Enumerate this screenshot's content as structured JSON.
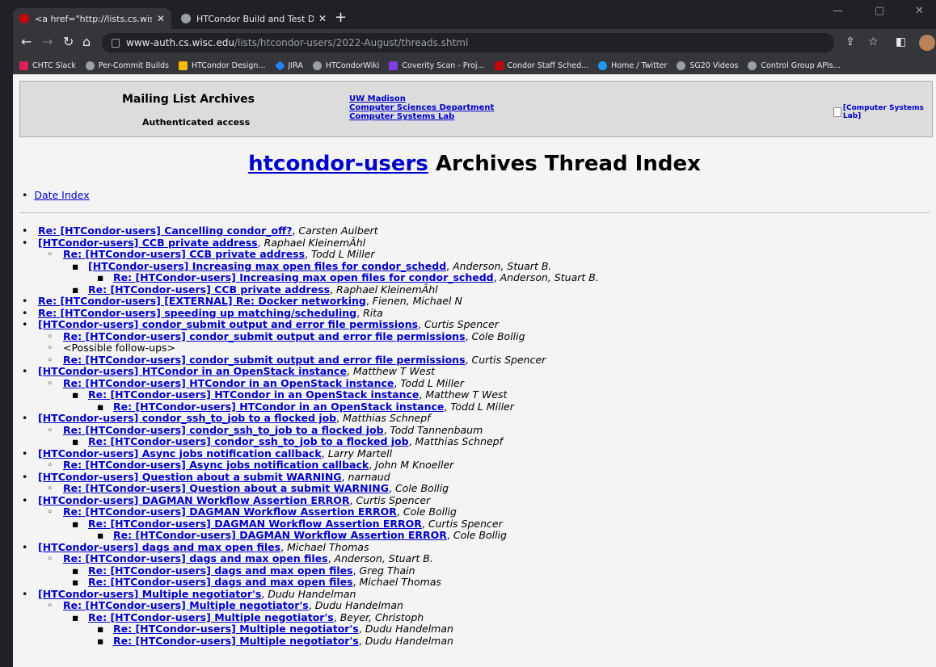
{
  "tabs": [
    {
      "title": "<a href=\"http://lists.cs.wisc.edu/",
      "fav_color": "#c5050c"
    },
    {
      "title": "HTCondor Build and Test Dashbo",
      "fav_color": "#9aa0a6"
    }
  ],
  "window_controls": {
    "minimize": "—",
    "maximize": "▢",
    "close": "✕"
  },
  "address": {
    "host": "www-auth.cs.wisc.edu",
    "path": "/lists/htcondor-users/2022-August/threads.shtml"
  },
  "bookmarks": [
    {
      "label": "CHTC Slack",
      "color": "#e01e5a"
    },
    {
      "label": "Per-Commit Builds",
      "color": "#9aa0a6"
    },
    {
      "label": "HTCondor Design...",
      "color": "#fbbc04"
    },
    {
      "label": "JIRA",
      "color": "#2684ff"
    },
    {
      "label": "HTCondorWiki",
      "color": "#9aa0a6"
    },
    {
      "label": "Coverity Scan - Proj...",
      "color": "#7b3fe4"
    },
    {
      "label": "Condor Staff Sched...",
      "color": "#c5050c"
    },
    {
      "label": "Home / Twitter",
      "color": "#1d9bf0"
    },
    {
      "label": "SG20 Videos",
      "color": "#9aa0a6"
    },
    {
      "label": "Control Group APIs...",
      "color": "#9aa0a6"
    }
  ],
  "header": {
    "title": "Mailing List Archives",
    "subtitle": "Authenticated access",
    "links": [
      "UW Madison",
      "Computer Sciences Department",
      "Computer Systems Lab"
    ],
    "image_alt": "[Computer Systems Lab]"
  },
  "page_title": {
    "link": "htcondor-users",
    "rest": " Archives Thread Index"
  },
  "date_index": "Date Index",
  "threads": [
    {
      "level": 0,
      "subject": "Re: [HTCondor-users] Cancelling condor_off?",
      "author": "Carsten Aulbert"
    },
    {
      "level": 0,
      "subject": "[HTCondor-users] CCB private address",
      "author": "Raphael KleinemÃhl"
    },
    {
      "level": 1,
      "subject": "Re: [HTCondor-users] CCB private address",
      "author": "Todd L Miller"
    },
    {
      "level": 2,
      "subject": "[HTCondor-users] Increasing max open files for condor_schedd",
      "author": "Anderson, Stuart B."
    },
    {
      "level": 3,
      "subject": "Re: [HTCondor-users] Increasing max open files for condor_schedd",
      "author": "Anderson, Stuart B."
    },
    {
      "level": 2,
      "subject": "Re: [HTCondor-users] CCB private address",
      "author": "Raphael KleinemÃhl"
    },
    {
      "level": 0,
      "subject": "Re: [HTCondor-users] [EXTERNAL] Re: Docker networking",
      "author": "Fienen, Michael N"
    },
    {
      "level": 0,
      "subject": "Re: [HTCondor-users] speeding up matching/scheduling",
      "author": "Rita"
    },
    {
      "level": 0,
      "subject": "[HTCondor-users] condor_submit output and error file permissions",
      "author": "Curtis Spencer"
    },
    {
      "level": 1,
      "subject": "Re: [HTCondor-users] condor_submit output and error file permissions",
      "author": "Cole Bollig"
    },
    {
      "level": 1,
      "text": "<Possible follow-ups>"
    },
    {
      "level": 1,
      "subject": "Re: [HTCondor-users] condor_submit output and error file permissions",
      "author": "Curtis Spencer"
    },
    {
      "level": 0,
      "subject": "[HTCondor-users] HTCondor in an OpenStack instance",
      "author": "Matthew T West"
    },
    {
      "level": 1,
      "subject": "Re: [HTCondor-users] HTCondor in an OpenStack instance",
      "author": "Todd L Miller"
    },
    {
      "level": 2,
      "subject": "Re: [HTCondor-users] HTCondor in an OpenStack instance",
      "author": "Matthew T West"
    },
    {
      "level": 3,
      "subject": "Re: [HTCondor-users] HTCondor in an OpenStack instance",
      "author": "Todd L Miller"
    },
    {
      "level": 0,
      "subject": "[HTCondor-users] condor_ssh_to_job to a flocked job",
      "author": "Matthias Schnepf"
    },
    {
      "level": 1,
      "subject": "Re: [HTCondor-users] condor_ssh_to_job to a flocked job",
      "author": "Todd Tannenbaum"
    },
    {
      "level": 2,
      "subject": "Re: [HTCondor-users] condor_ssh_to_job to a flocked job",
      "author": "Matthias Schnepf"
    },
    {
      "level": 0,
      "subject": "[HTCondor-users] Async jobs notification callback",
      "author": "Larry Martell"
    },
    {
      "level": 1,
      "subject": "Re: [HTCondor-users] Async jobs notification callback",
      "author": "John M Knoeller"
    },
    {
      "level": 0,
      "subject": "[HTCondor-users] Question about a submit WARNING",
      "author": "narnaud"
    },
    {
      "level": 1,
      "subject": "Re: [HTCondor-users] Question about a submit WARNING",
      "author": "Cole Bollig"
    },
    {
      "level": 0,
      "subject": "[HTCondor-users] DAGMAN Workflow Assertion ERROR",
      "author": "Curtis Spencer"
    },
    {
      "level": 1,
      "subject": "Re: [HTCondor-users] DAGMAN Workflow Assertion ERROR",
      "author": "Cole Bollig"
    },
    {
      "level": 2,
      "subject": "Re: [HTCondor-users] DAGMAN Workflow Assertion ERROR",
      "author": "Curtis Spencer"
    },
    {
      "level": 3,
      "subject": "Re: [HTCondor-users] DAGMAN Workflow Assertion ERROR",
      "author": "Cole Bollig"
    },
    {
      "level": 0,
      "subject": "[HTCondor-users] dags and max open files",
      "author": "Michael Thomas"
    },
    {
      "level": 1,
      "subject": "Re: [HTCondor-users] dags and max open files",
      "author": "Anderson, Stuart B."
    },
    {
      "level": 2,
      "subject": "Re: [HTCondor-users] dags and max open files",
      "author": "Greg Thain"
    },
    {
      "level": 2,
      "subject": "Re: [HTCondor-users] dags and max open files",
      "author": "Michael Thomas"
    },
    {
      "level": 0,
      "subject": "[HTCondor-users] Multiple negotiator's",
      "author": "Dudu Handelman"
    },
    {
      "level": 1,
      "subject": "Re: [HTCondor-users] Multiple negotiator's",
      "author": "Dudu Handelman"
    },
    {
      "level": 2,
      "subject": "Re: [HTCondor-users] Multiple negotiator's",
      "author": "Beyer, Christoph"
    },
    {
      "level": 3,
      "subject": "Re: [HTCondor-users] Multiple negotiator's",
      "author": "Dudu Handelman"
    },
    {
      "level": 3,
      "subject": "Re: [HTCondor-users] Multiple negotiator's",
      "author": "Dudu Handelman"
    }
  ]
}
